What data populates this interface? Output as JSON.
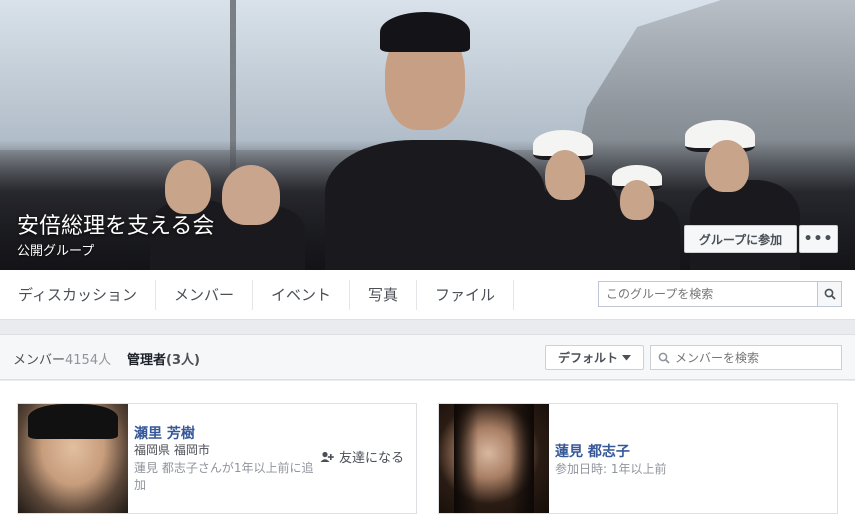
{
  "group": {
    "title": "安倍総理を支える会",
    "privacy": "公開グループ",
    "join_label": "グループに参加",
    "more_label": "•••"
  },
  "tabs": [
    {
      "label": "ディスカッション"
    },
    {
      "label": "メンバー"
    },
    {
      "label": "イベント"
    },
    {
      "label": "写真"
    },
    {
      "label": "ファイル"
    }
  ],
  "group_search": {
    "placeholder": "このグループを検索"
  },
  "members_header": {
    "members_label": "メンバー",
    "members_count": "4154人",
    "admins_label": "管理者",
    "admins_count": "(3人)",
    "sort_label": "デフォルト",
    "search_placeholder": "メンバーを検索"
  },
  "members": [
    {
      "name": "瀬里 芳樹",
      "location": "福岡県 福岡市",
      "added_by": "蓮見 都志子さんが1年以上前に追加",
      "action_label": "友達になる"
    },
    {
      "name": "蓮見 都志子",
      "joined": "参加日時: 1年以上前"
    }
  ],
  "colors": {
    "link": "#365899",
    "panel_bg": "#f6f7f9",
    "page_bg": "#e9ebee"
  }
}
